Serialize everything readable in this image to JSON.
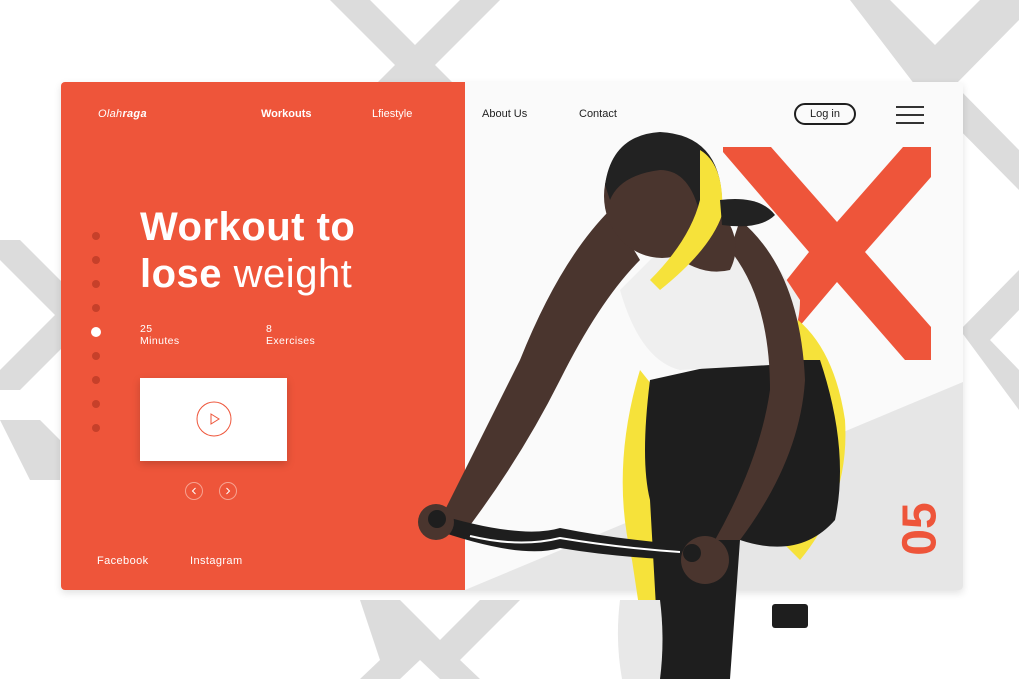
{
  "brand": {
    "logo_prefix": "Olah",
    "logo_suffix": "raga"
  },
  "nav": {
    "workouts": "Workouts",
    "lifestyle": "Lfiestyle",
    "about": "About Us",
    "contact": "Contact",
    "login": "Log in"
  },
  "hero": {
    "line1": "Workout to",
    "line2_bold": "lose",
    "line2_regular": "weight"
  },
  "stats": [
    {
      "value": "25",
      "label": "Minutes"
    },
    {
      "value": "8",
      "label": "Exercises"
    }
  ],
  "slider": {
    "total_dots": 9,
    "active_dot_index": 4,
    "slide_number": "05"
  },
  "social": {
    "facebook": "Facebook",
    "instagram": "Instagram"
  },
  "icons": {
    "play": "play-icon",
    "prev": "chevron-left-icon",
    "next": "chevron-right-icon",
    "menu": "hamburger-menu-icon"
  },
  "colors": {
    "accent": "#ee553a",
    "pattern": "#dcdcdc",
    "illustration_yellow": "#f6e23a",
    "skin": "#4a352e",
    "dark": "#1e1e1e"
  }
}
